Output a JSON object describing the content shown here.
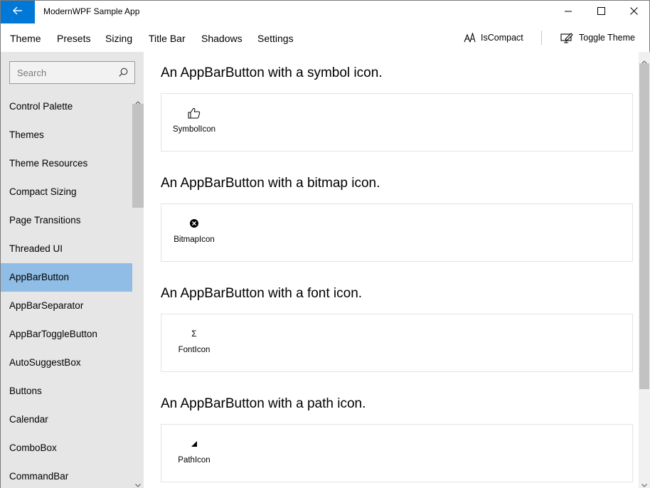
{
  "window": {
    "title": "ModernWPF Sample App",
    "back_icon": "back-arrow-icon",
    "caption_icons": [
      "minimize-icon",
      "maximize-icon",
      "close-icon"
    ],
    "accent_color": "#0078d7"
  },
  "menu": {
    "items": [
      "Theme",
      "Presets",
      "Sizing",
      "Title Bar",
      "Shadows",
      "Settings"
    ],
    "commands": [
      {
        "label": "IsCompact",
        "icon": "font-size-icon"
      },
      {
        "label": "Toggle Theme",
        "icon": "theme-edit-icon"
      }
    ]
  },
  "sidebar": {
    "search_placeholder": "Search",
    "search_value": "",
    "selected_color": "#90bde5",
    "items": [
      {
        "label": "Control Palette"
      },
      {
        "label": "Themes"
      },
      {
        "label": "Theme Resources"
      },
      {
        "label": "Compact Sizing"
      },
      {
        "label": "Page Transitions"
      },
      {
        "label": "Threaded UI"
      },
      {
        "label": "AppBarButton",
        "selected": true
      },
      {
        "label": "AppBarSeparator"
      },
      {
        "label": "AppBarToggleButton"
      },
      {
        "label": "AutoSuggestBox"
      },
      {
        "label": "Buttons"
      },
      {
        "label": "Calendar"
      },
      {
        "label": "ComboBox"
      },
      {
        "label": "CommandBar"
      }
    ]
  },
  "main": {
    "sections": [
      {
        "title": "An AppBarButton with a symbol icon.",
        "button_label": "SymbolIcon",
        "icon": "thumbs-up-icon"
      },
      {
        "title": "An AppBarButton with a bitmap icon.",
        "button_label": "BitmapIcon",
        "icon": "bitmap-x-icon"
      },
      {
        "title": "An AppBarButton with a font icon.",
        "button_label": "FontIcon",
        "icon": "sigma-icon",
        "glyph": "Σ"
      },
      {
        "title": "An AppBarButton with a path icon.",
        "button_label": "PathIcon",
        "icon": "triangle-path-icon"
      }
    ]
  }
}
